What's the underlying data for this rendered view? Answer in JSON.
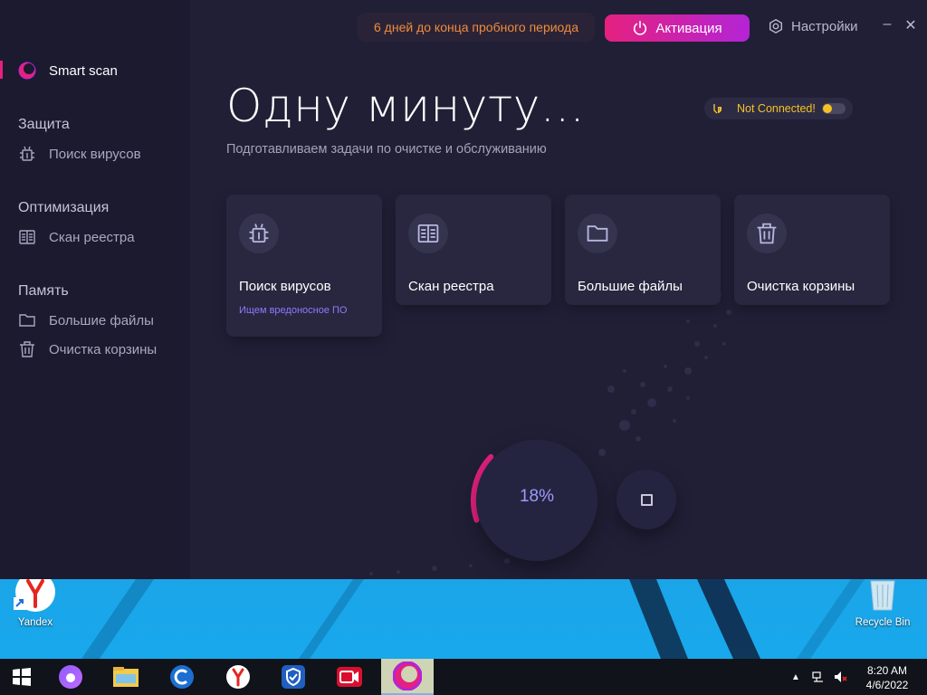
{
  "window": {
    "trial_text": "6 дней до конца пробного периода",
    "activate_label": "Активация",
    "settings_label": "Настройки",
    "minimize_glyph": "–",
    "close_glyph": "✕"
  },
  "sidebar": {
    "smart_scan": "Smart scan",
    "sections": [
      {
        "title": "Защита",
        "items": [
          {
            "label": "Поиск вирусов",
            "icon": "bug-icon"
          }
        ]
      },
      {
        "title": "Оптимизация",
        "items": [
          {
            "label": "Скан реестра",
            "icon": "registry-book-icon"
          }
        ]
      },
      {
        "title": "Память",
        "items": [
          {
            "label": "Большие файлы",
            "icon": "folder-icon"
          },
          {
            "label": "Очистка корзины",
            "icon": "trash-icon"
          }
        ]
      }
    ]
  },
  "main": {
    "headline": "Одну минуту...",
    "subtitle": "Подготавливаем задачи по очистке и обслуживанию",
    "vpn_status": "Not Connected!",
    "cards": [
      {
        "title": "Поиск вирусов",
        "subtitle": "Ищем вредоносное ПО",
        "icon": "bug-icon"
      },
      {
        "title": "Скан реестра",
        "icon": "registry-book-icon"
      },
      {
        "title": "Большие файлы",
        "icon": "folder-icon"
      },
      {
        "title": "Очистка корзины",
        "icon": "trash-icon"
      }
    ],
    "progress_text": "18%",
    "progress_value": 0.18
  },
  "desktop": {
    "icons": [
      {
        "label": "Yandex",
        "icon": "yandex-browser-icon"
      },
      {
        "label": "Recycle Bin",
        "icon": "recycle-bin-icon"
      }
    ]
  },
  "taskbar": {
    "apps": [
      "windows-start-icon",
      "alice-icon",
      "file-explorer-icon",
      "ccleaner-icon",
      "yandex-browser-icon",
      "vpn-shield-icon",
      "screen-recorder-icon",
      "cleaner-app-icon"
    ],
    "time": "8:20 AM",
    "date": "4/6/2022"
  },
  "colors": {
    "accent_pink": "#e5217f",
    "accent_purple": "#b324d6",
    "trial_orange": "#f08c3a",
    "vpn_yellow": "#f5c224",
    "progress_text": "#9d9bff"
  }
}
